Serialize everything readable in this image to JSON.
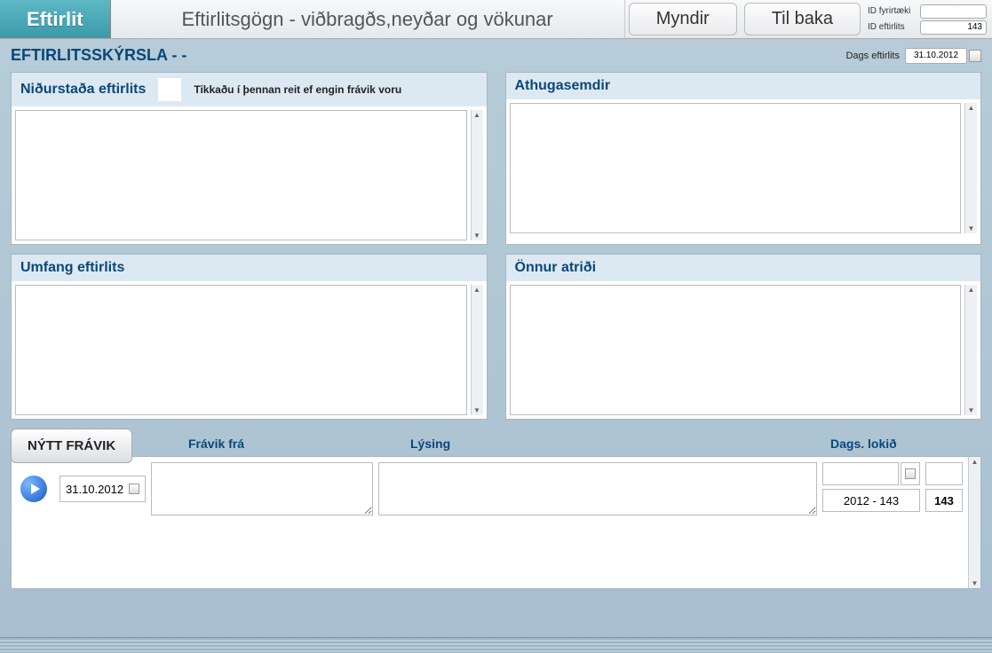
{
  "header": {
    "tab_active": "Eftirlit",
    "title": "Eftirlitsgögn - viðbragðs,neyðar og vökunar",
    "btn_myndir": "Myndir",
    "btn_tilbaka": "Til baka",
    "id_fyrirtaeki_label": "ID fyrirtæki",
    "id_fyrirtaeki_value": "",
    "id_eftirlits_label": "ID eftirlits",
    "id_eftirlits_value": "143"
  },
  "report": {
    "title": "EFTIRLITSSKÝRSLA   -  -",
    "dags_label": "Dags eftirlits",
    "dags_value": "31.10.2012"
  },
  "panels": {
    "nidurstada": {
      "title": "Niðurstaða eftirlits",
      "checkbox_label": "Tikkaðu í þennan reit ef engin frávik voru",
      "value": ""
    },
    "athugasemdir": {
      "title": "Athugasemdir",
      "value": ""
    },
    "umfang": {
      "title": "Umfang eftirlits",
      "value": ""
    },
    "onnur": {
      "title": "Önnur atriði",
      "value": ""
    }
  },
  "lower": {
    "new_btn": "NÝTT FRÁVIK",
    "col_fravik_fra": "Frávik frá",
    "col_lysing": "Lýsing",
    "col_dags_lokid": "Dags. lokið",
    "row": {
      "date": "31.10.2012",
      "fravik_fra": "",
      "lysing": "",
      "dags_lokid": "",
      "code": "2012 - 143",
      "num": "143"
    }
  }
}
